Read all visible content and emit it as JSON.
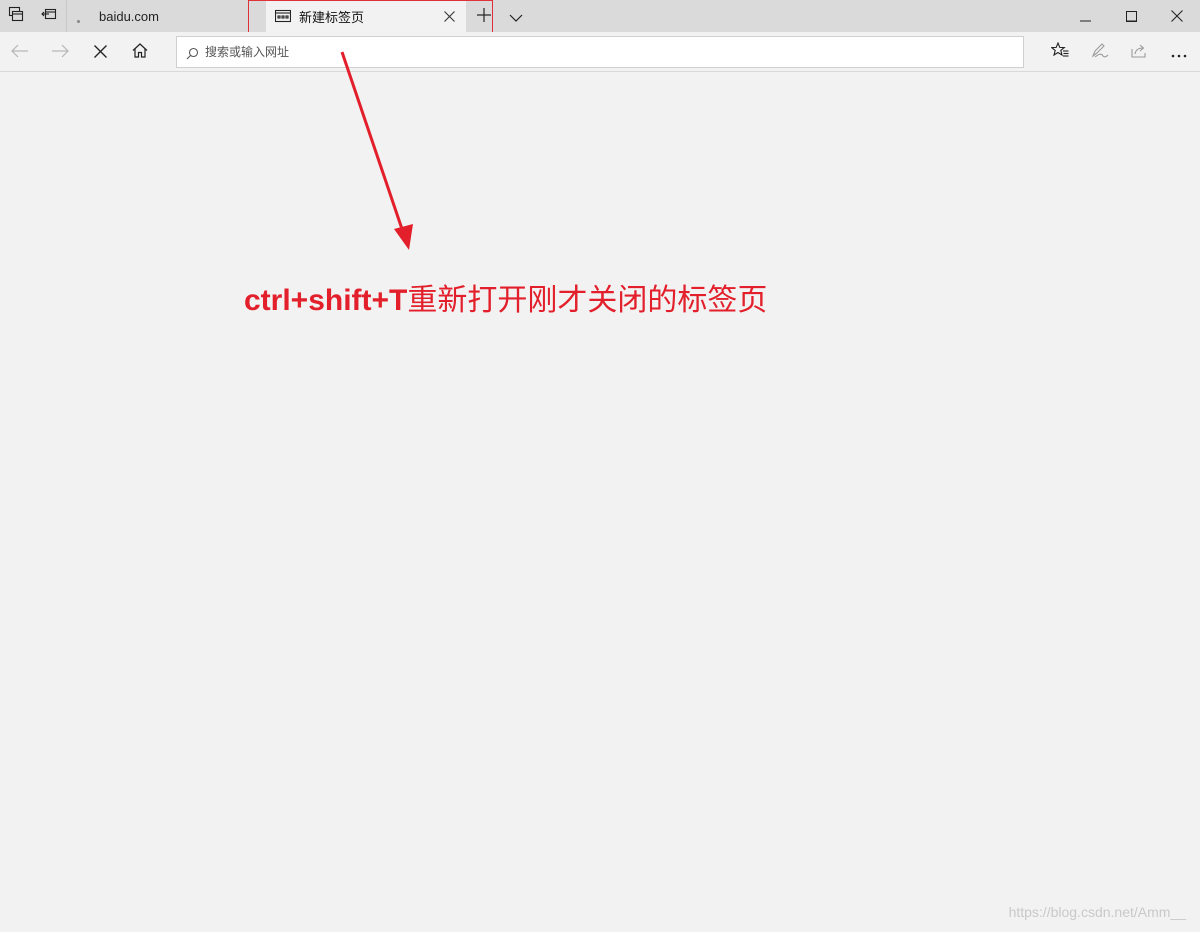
{
  "tabs": [
    {
      "label": "baidu.com",
      "active": false,
      "loading": true
    },
    {
      "label": "新建标签页",
      "active": true
    }
  ],
  "tabstrip": {
    "icons": [
      "tabs-aside-icon",
      "restore-tabs-icon",
      "new-tab-plus-icon",
      "tab-list-chevron-icon"
    ]
  },
  "window_controls": [
    "minimize-icon",
    "maximize-icon",
    "close-icon"
  ],
  "navbar": {
    "address_placeholder": "搜索或输入网址",
    "address_value": "",
    "buttons": [
      "back-arrow-icon",
      "forward-arrow-icon",
      "stop-loading-icon",
      "home-icon",
      "favorites-star-icon",
      "pen-notes-icon",
      "share-icon",
      "more-dots-icon"
    ]
  },
  "annotation": {
    "shortcut": "ctrl+shift+T",
    "text": "重新打开刚才关闭的标签页",
    "color": "#e21f2a"
  },
  "watermark": "https://blog.csdn.net/Amm__",
  "colors": {
    "tabstrip_bg": "#dadada",
    "page_bg": "#f2f2f2",
    "highlight": "#e0303a"
  }
}
